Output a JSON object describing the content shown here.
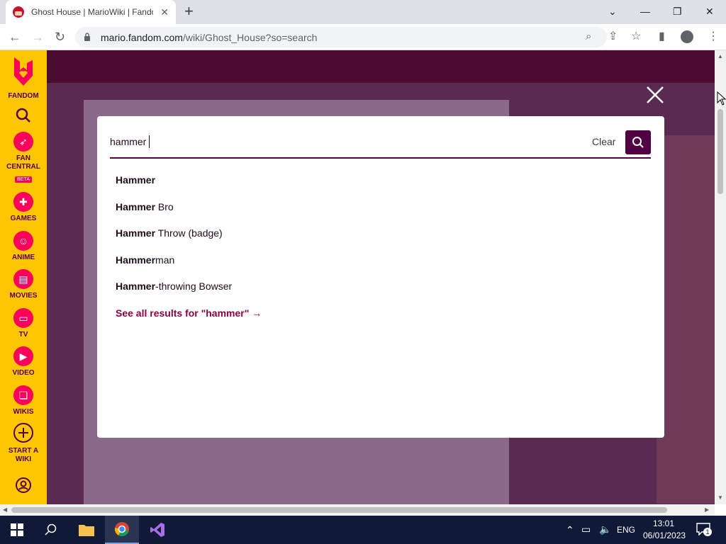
{
  "browser": {
    "tab_title": "Ghost House | MarioWiki | Fandom",
    "url_domain": "mario.fandom.com",
    "url_path": "/wiki/Ghost_House?so=search"
  },
  "sidebar": {
    "brand_label": "FANDOM",
    "items": [
      {
        "label": "FAN CENTRAL",
        "badge": "BETA"
      },
      {
        "label": "GAMES"
      },
      {
        "label": "ANIME"
      },
      {
        "label": "MOVIES"
      },
      {
        "label": "TV"
      },
      {
        "label": "VIDEO"
      },
      {
        "label": "WIKIS"
      },
      {
        "label": "START A WIKI"
      }
    ]
  },
  "search": {
    "query": "hammer",
    "clear_label": "Clear",
    "suggestions": [
      {
        "bold": "Hammer",
        "rest": ""
      },
      {
        "bold": "Hammer",
        "rest": " Bro"
      },
      {
        "bold": "Hammer",
        "rest": " Throw (badge)"
      },
      {
        "bold": "Hammer",
        "rest": "man"
      },
      {
        "bold": "Hammer",
        "rest": "-throwing Bowser"
      }
    ],
    "see_all_label": "See all results for \"hammer\" →"
  },
  "taskbar": {
    "lang": "ENG",
    "time": "13:01",
    "date": "06/01/2023",
    "notification_count": "1"
  },
  "colors": {
    "fandom_yellow": "#ffc500",
    "fandom_pink": "#fa005a",
    "search_accent": "#520044",
    "link_color": "#8a0044"
  }
}
